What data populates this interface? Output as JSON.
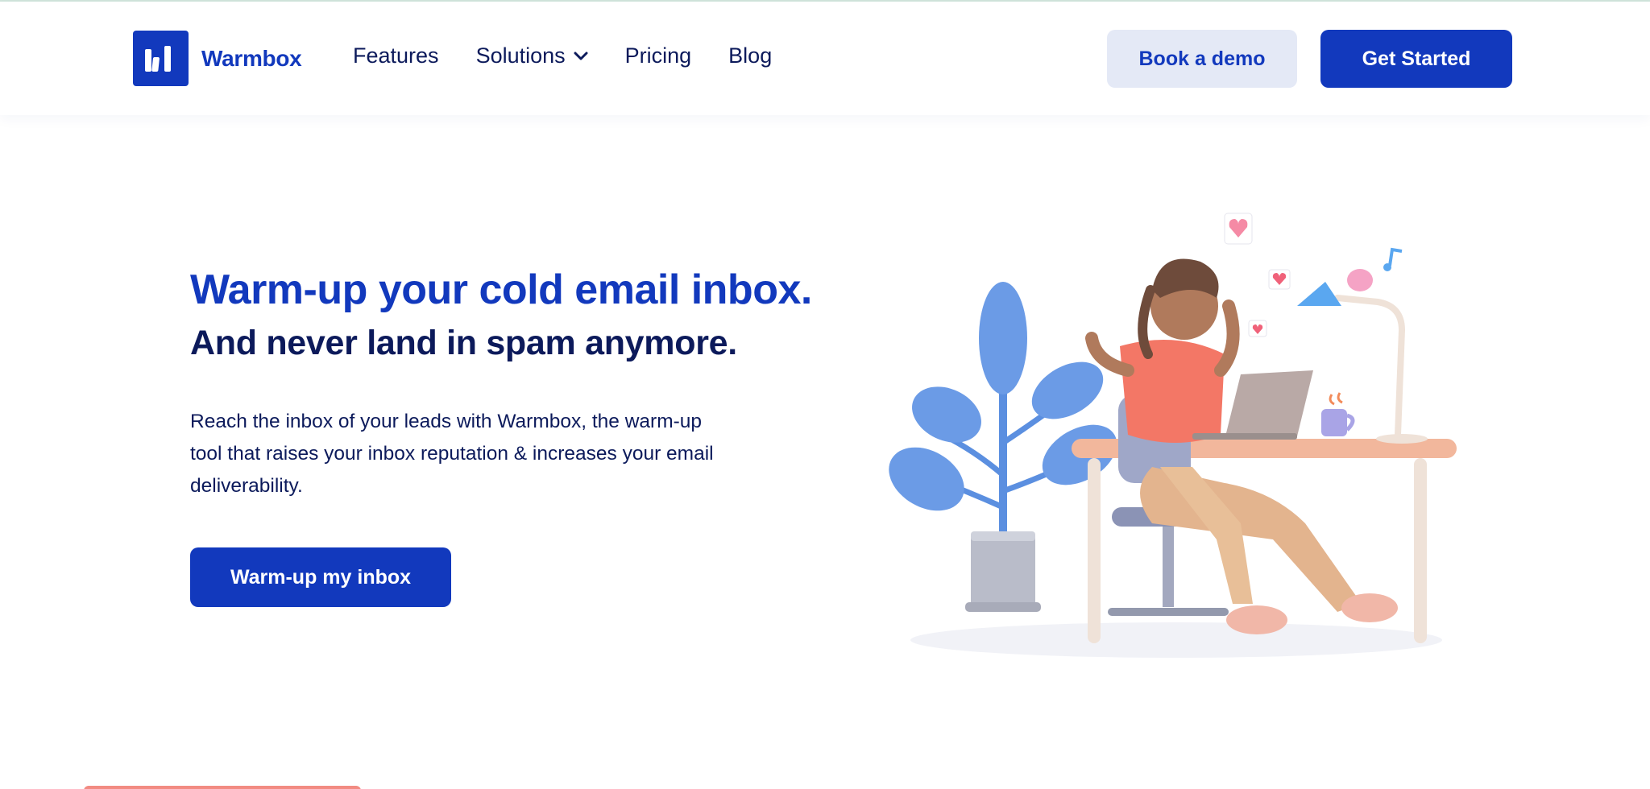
{
  "brand": {
    "name": "Warmbox",
    "color": "#1239bd"
  },
  "nav": {
    "items": [
      {
        "label": "Features"
      },
      {
        "label": "Solutions",
        "icon": "chevron-down-icon"
      },
      {
        "label": "Pricing"
      },
      {
        "label": "Blog"
      }
    ]
  },
  "header_actions": {
    "demo_label": "Book a demo",
    "start_label": "Get Started"
  },
  "hero": {
    "title": "Warm-up your cold email inbox.",
    "subtitle": "And never land in spam anymore.",
    "description": "Reach the inbox of your leads with Warmbox, the warm-up tool that raises your inbox reputation & increases your email deliverability.",
    "cta_label": "Warm-up my inbox"
  },
  "colors": {
    "primary": "#1239bd",
    "navy": "#0c1a5b",
    "secondary_button_bg": "#e4e9f6",
    "accent": "#f28b82"
  }
}
